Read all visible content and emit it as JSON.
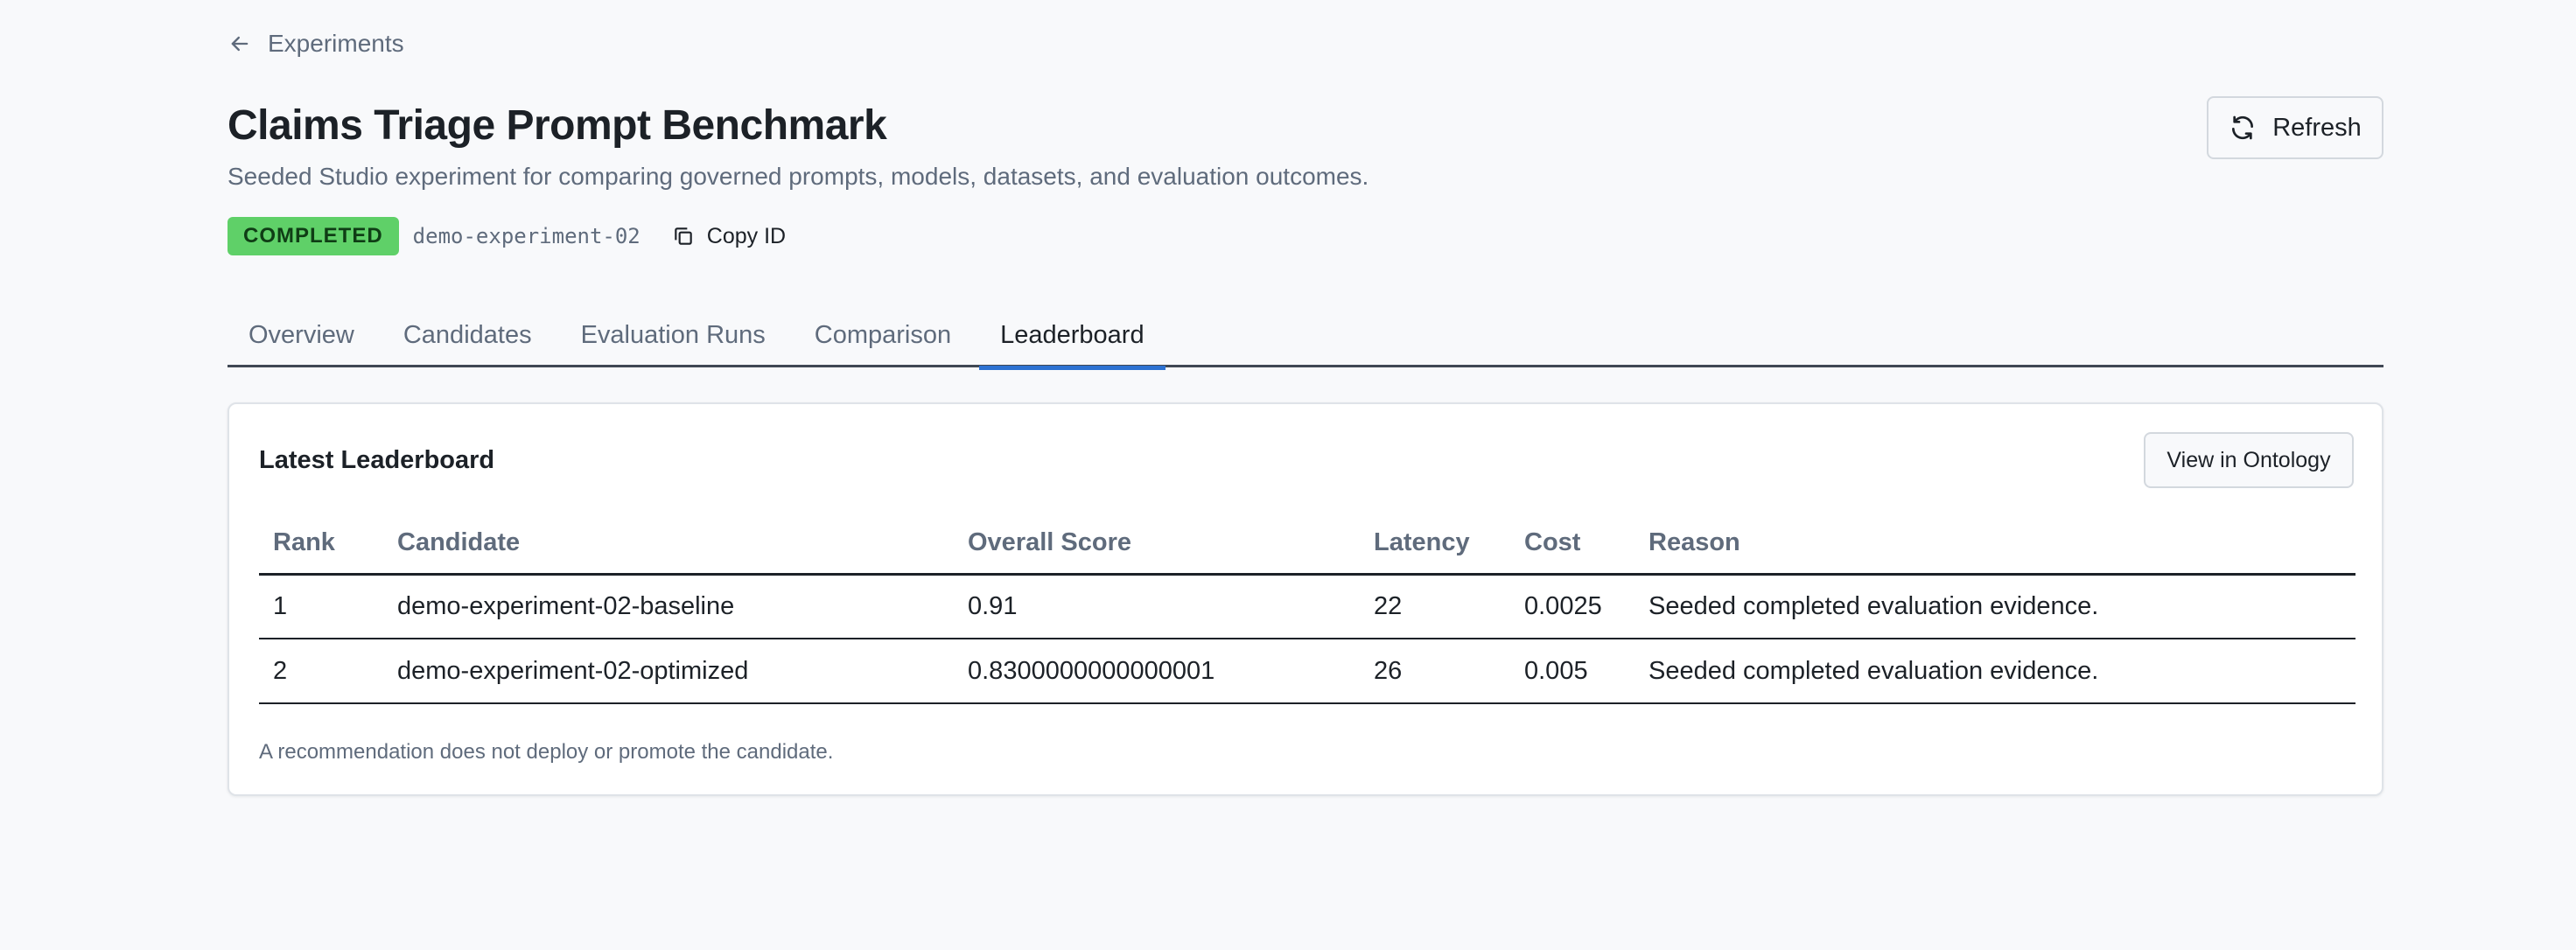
{
  "nav": {
    "back_label": "Experiments"
  },
  "header": {
    "title": "Claims Triage Prompt Benchmark",
    "subtitle": "Seeded Studio experiment for comparing governed prompts, models, datasets, and evaluation outcomes.",
    "status": "COMPLETED",
    "experiment_id": "demo-experiment-02",
    "copy_label": "Copy ID",
    "refresh_label": "Refresh"
  },
  "tabs": [
    {
      "label": "Overview"
    },
    {
      "label": "Candidates"
    },
    {
      "label": "Evaluation Runs"
    },
    {
      "label": "Comparison"
    },
    {
      "label": "Leaderboard"
    }
  ],
  "active_tab": "Leaderboard",
  "leaderboard": {
    "title": "Latest Leaderboard",
    "ontology_button": "View in Ontology",
    "columns": [
      "Rank",
      "Candidate",
      "Overall Score",
      "Latency",
      "Cost",
      "Reason"
    ],
    "rows": [
      [
        "1",
        "demo-experiment-02-baseline",
        "0.91",
        "22",
        "0.0025",
        "Seeded completed evaluation evidence."
      ],
      [
        "2",
        "demo-experiment-02-optimized",
        "0.8300000000000001",
        "26",
        "0.005",
        "Seeded completed evaluation evidence."
      ]
    ],
    "note": "A recommendation does not deploy or promote the candidate."
  },
  "colors": {
    "status_badge": "#5fd068",
    "active_tab_indicator": "#2d72d2"
  },
  "icons": {
    "back": "arrow-left-icon",
    "copy": "copy-icon",
    "refresh": "refresh-icon"
  }
}
